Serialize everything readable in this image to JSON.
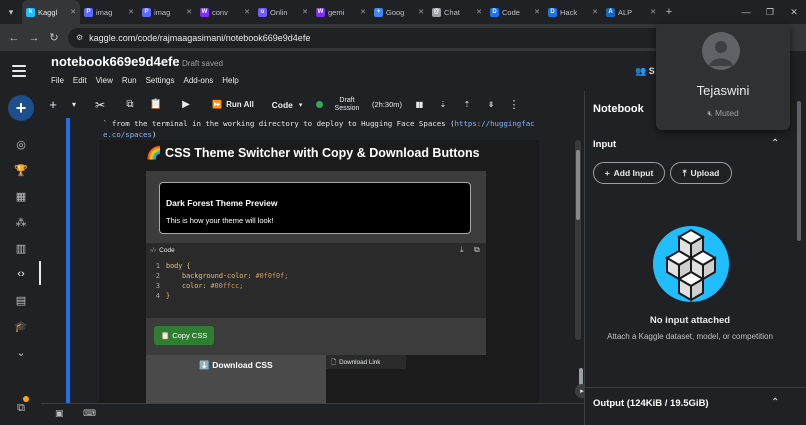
{
  "browser": {
    "tabs": [
      {
        "title": "Kaggl",
        "fav": "k",
        "color": "#20beff",
        "active": true
      },
      {
        "title": "imag",
        "fav": "P",
        "color": "#5b6bff"
      },
      {
        "title": "imag",
        "fav": "P",
        "color": "#5b6bff"
      },
      {
        "title": "conv",
        "fav": "W",
        "color": "#7b2ff7"
      },
      {
        "title": "Onlin",
        "fav": "o",
        "color": "#6f5bff"
      },
      {
        "title": "gemi",
        "fav": "W",
        "color": "#7b2ff7"
      },
      {
        "title": "Goog",
        "fav": "+",
        "color": "#4285f4"
      },
      {
        "title": "Chat",
        "fav": "@",
        "color": "#9aa0a6"
      },
      {
        "title": "Code",
        "fav": "D",
        "color": "#1a73e8"
      },
      {
        "title": "Hack",
        "fav": "D",
        "color": "#1a73e8"
      },
      {
        "title": "ALP",
        "fav": "A",
        "color": "#1565c0"
      }
    ],
    "url": "kaggle.com/code/rajmaagasimani/notebook669e9d4efe"
  },
  "header": {
    "title": "notebook669e9d4efe",
    "status": "Draft saved",
    "menu": [
      "File",
      "Edit",
      "View",
      "Run",
      "Settings",
      "Add-ons",
      "Help"
    ],
    "share_label": "S"
  },
  "toolbar": {
    "run_all": "Run All",
    "cell_type": "Code",
    "session_label": "Draft Session",
    "session_line1": "Draft",
    "session_line2": "Session",
    "session_time": "(2h:30m)"
  },
  "output": {
    "line1_text": "` from the terminal in the working directory to deploy to Hugging Face Spaces (",
    "line1_link": "https://huggingfac",
    "line2_link": "e.co/spaces",
    "line2_end": ")",
    "app_title": "🌈 CSS Theme Switcher with Copy & Download Buttons",
    "preview_heading": "Dark Forest Theme Preview",
    "preview_text": "This is how your theme will look!",
    "code_label": "Code",
    "code_lines": [
      {
        "n": "1",
        "text": "body {"
      },
      {
        "n": "2",
        "prop": "background-color:",
        "val": "#0f0f0f;"
      },
      {
        "n": "3",
        "prop": "color:",
        "val": "#00ffcc;"
      },
      {
        "n": "4",
        "text": "}"
      }
    ],
    "copy_button": "📋 Copy CSS",
    "download_button": "⬇️ Download CSS",
    "download_link": "Download Link"
  },
  "panel": {
    "title": "Notebook",
    "input_heading": "Input",
    "add_input": "Add Input",
    "upload": "Upload",
    "empty_title": "No input attached",
    "empty_text": "Attach a Kaggle dataset, model, or competition",
    "output_heading": "Output (124KiB / 19.5GiB)"
  },
  "profile": {
    "name": "Tejaswini",
    "status": "Muted"
  }
}
